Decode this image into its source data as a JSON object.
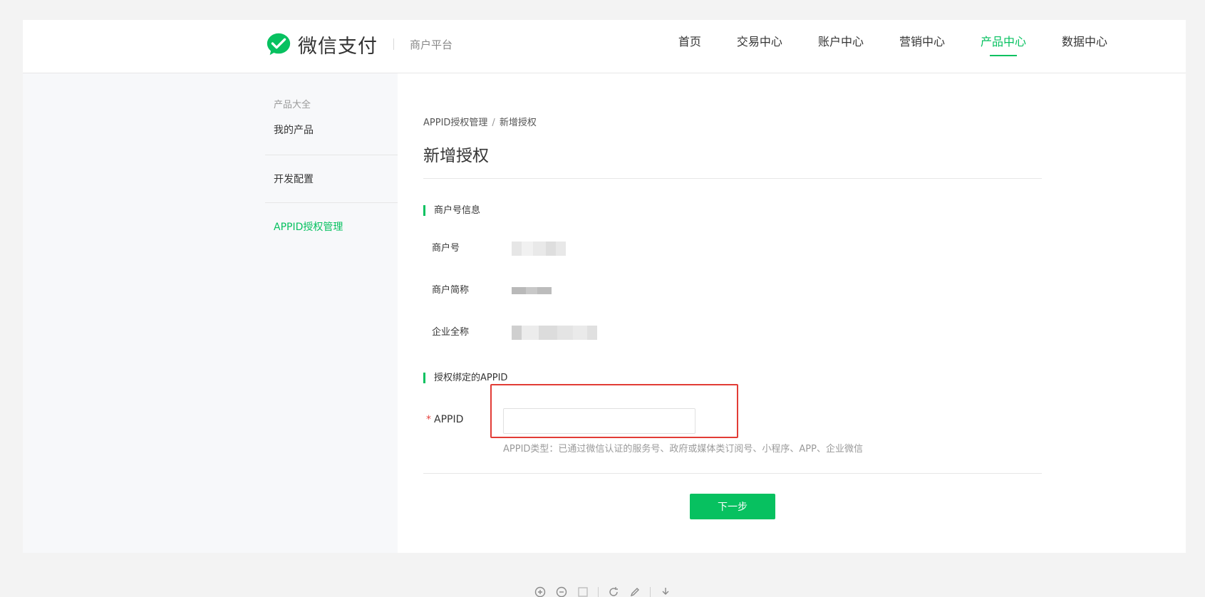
{
  "header": {
    "brand": "微信支付",
    "subtitle": "商户平台",
    "nav": [
      {
        "label": "首页",
        "active": false
      },
      {
        "label": "交易中心",
        "active": false
      },
      {
        "label": "账户中心",
        "active": false
      },
      {
        "label": "营销中心",
        "active": false
      },
      {
        "label": "产品中心",
        "active": true
      },
      {
        "label": "数据中心",
        "active": false
      }
    ]
  },
  "sidebar": {
    "group_title": "产品大全",
    "items": [
      "我的产品",
      "开发配置",
      "APPID授权管理"
    ],
    "active_index": 2
  },
  "main": {
    "breadcrumb": [
      "APPID授权管理",
      "新增授权"
    ],
    "breadcrumb_separator": "/",
    "title": "新增授权",
    "merchant_section": {
      "title": "商户号信息",
      "fields": [
        {
          "label": "商户号"
        },
        {
          "label": "商户简称"
        },
        {
          "label": "企业全称"
        }
      ]
    },
    "appid_section": {
      "title": "授权绑定的APPID",
      "required_mark": "*",
      "field_label": "APPID",
      "input_value": "",
      "help_text": "APPID类型：已通过微信认证的服务号、政府或媒体类订阅号、小程序、APP、企业微信"
    },
    "next_button": "下一步"
  },
  "toolbar": {
    "icons": [
      "zoom-in-icon",
      "zoom-out-icon",
      "fit-icon",
      "rotate-icon",
      "edit-icon",
      "download-icon"
    ]
  },
  "colors": {
    "accent": "#07c160",
    "highlight": "#e23c36",
    "required": "#e64340"
  }
}
